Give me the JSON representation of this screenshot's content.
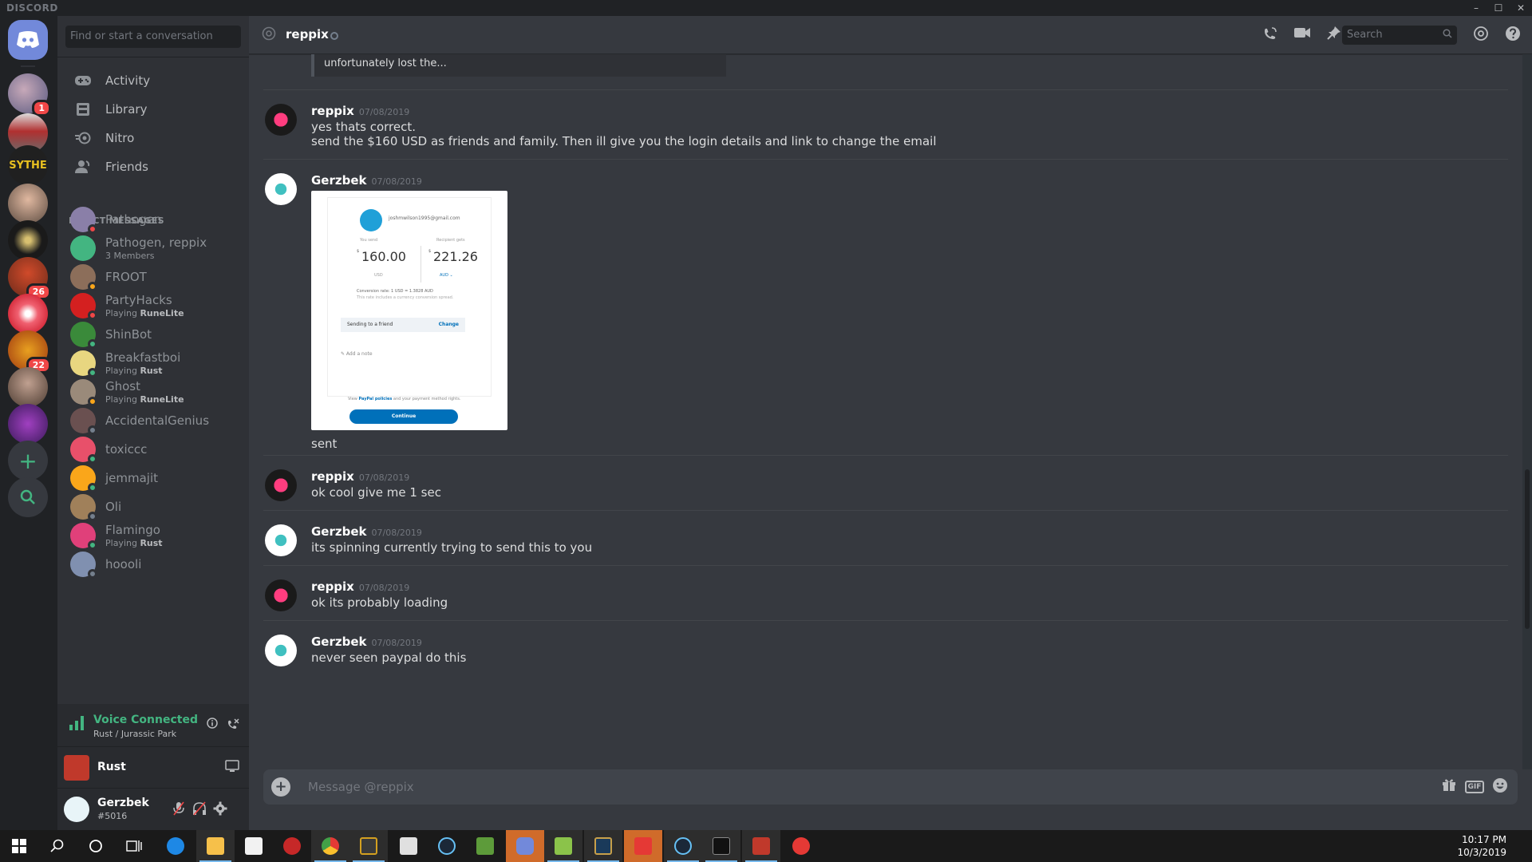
{
  "titlebar": {
    "brand": "DISCORD",
    "min": "–",
    "max": "☐",
    "close": "✕"
  },
  "guilds": {
    "badges": [
      "1",
      "26",
      "22"
    ],
    "sythe_label": "SYTHE",
    "add": "+",
    "explore": "⌕"
  },
  "sidebar": {
    "find_placeholder": "Find or start a conversation",
    "nav": [
      {
        "label": "Activity",
        "icon": "gamepad-icon"
      },
      {
        "label": "Library",
        "icon": "library-icon"
      },
      {
        "label": "Nitro",
        "icon": "nitro-icon"
      },
      {
        "label": "Friends",
        "icon": "friends-icon"
      }
    ],
    "dm_header": "DIRECT MESSAGES",
    "dms": [
      {
        "name": "Pathogen",
        "sub": "",
        "status": "#f04747",
        "color": "#8a7fa8"
      },
      {
        "name": "Pathogen, reppix",
        "sub": "3 Members",
        "status": "",
        "color": "#43b581"
      },
      {
        "name": "FROOT",
        "sub": "",
        "status": "#faa61a",
        "color": "#8c6e5a"
      },
      {
        "name": "PartyHacks",
        "sub_pre": "Playing ",
        "sub_game": "RuneLite",
        "status": "#f04747",
        "color": "#d42020"
      },
      {
        "name": "ShinBot",
        "sub": "",
        "status": "#43b581",
        "color": "#3a8a3a"
      },
      {
        "name": "Breakfastboi",
        "sub_pre": "Playing ",
        "sub_game": "Rust",
        "status": "#43b581",
        "color": "#e8d680"
      },
      {
        "name": "Ghost",
        "sub_pre": "Playing ",
        "sub_game": "RuneLite",
        "status": "#faa61a",
        "color": "#9a8a7a"
      },
      {
        "name": "AccidentalGenius",
        "sub": "",
        "status": "#747f8d",
        "color": "#6a5050"
      },
      {
        "name": "toxiccc",
        "sub": "",
        "status": "#43b581",
        "color": "#e8506a"
      },
      {
        "name": "jemmajit",
        "sub": "",
        "status": "#43b581",
        "color": "#faa61a"
      },
      {
        "name": "Oli",
        "sub": "",
        "status": "#747f8d",
        "color": "#a0805a"
      },
      {
        "name": "Flamingo",
        "sub_pre": "Playing ",
        "sub_game": "Rust",
        "status": "#43b581",
        "color": "#e0407a"
      },
      {
        "name": "hoooli",
        "sub": "",
        "status": "#747f8d",
        "color": "#8090b0"
      }
    ],
    "voice": {
      "title": "Voice Connected",
      "sub": "Rust / Jurassic Park"
    },
    "game": {
      "name": "Rust"
    },
    "user": {
      "name": "Gerzbek",
      "disc": "#5016"
    }
  },
  "chat": {
    "channel": "reppix",
    "search_placeholder": "Search",
    "embed_tail": "unfortunately lost the...",
    "messages": [
      {
        "author": "reppix",
        "ts": "07/08/2019",
        "lines": [
          "yes thats correct.",
          "send the $160 USD as friends and family. Then ill give you the login details and link to change the email"
        ]
      },
      {
        "author": "Gerzbek",
        "ts": "07/08/2019",
        "lines": [
          "sent"
        ]
      },
      {
        "author": "reppix",
        "ts": "07/08/2019",
        "lines": [
          "ok cool give me 1 sec"
        ]
      },
      {
        "author": "Gerzbek",
        "ts": "07/08/2019",
        "lines": [
          "its spinning currently trying to send this to you"
        ]
      },
      {
        "author": "reppix",
        "ts": "07/08/2019",
        "lines": [
          "ok its probably loading"
        ]
      },
      {
        "author": "Gerzbek",
        "ts": "07/08/2019",
        "lines": [
          "never seen paypal do this"
        ]
      }
    ],
    "attachment": {
      "email": "joshmwilson1995@gmail.com",
      "you_send_label": "You send",
      "recipient_label": "Recipient gets",
      "send_amount": "160.00",
      "receive_amount": "221.26",
      "currency_symbol": "$",
      "send_currency": "USD",
      "receive_currency": "AUD ⌄",
      "conversion": "Conversion rate: 1 USD = 1.3828 AUD",
      "conversion_note": "This rate includes a currency conversion spread.",
      "sending_to": "Sending to a friend",
      "change": "Change",
      "add_note": "✎ Add a note",
      "policy_pre": "View ",
      "policy_link": "PayPal policies",
      "policy_post": " and your payment method rights.",
      "continue": "Continue"
    },
    "composer_placeholder": "Message @reppix"
  },
  "taskbar": {
    "time": "10:17 PM",
    "date": "10/3/2019"
  }
}
